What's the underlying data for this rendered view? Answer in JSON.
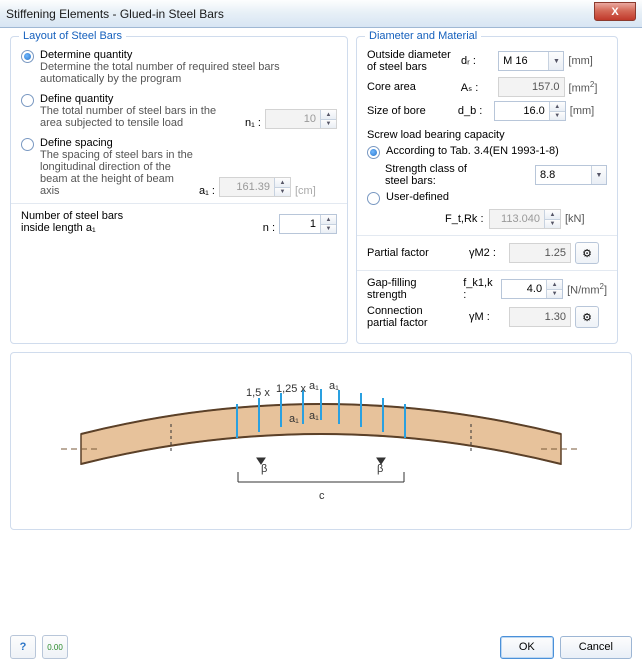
{
  "title": "Stiffening Elements - Glued-in Steel Bars",
  "close_x": "X",
  "left": {
    "legend": "Layout of Steel Bars",
    "opt1_title": "Determine quantity",
    "opt1_desc": "Determine the total number of required steel bars automatically by the program",
    "opt2_title": "Define quantity",
    "opt2_desc": "The total number of steel bars in the area subjected to tensile load",
    "opt2_sym": "n₁ :",
    "opt2_val": "10",
    "opt3_title": "Define spacing",
    "opt3_desc": "The spacing of steel bars in the longitudinal direction of the beam at the height of beam axis",
    "opt3_sym": "a₁ :",
    "opt3_val": "161.39",
    "opt3_unit": "[cm]",
    "nbars_lbl1": "Number of steel bars",
    "nbars_lbl2": "inside length a₁",
    "nbars_sym": "n :",
    "nbars_val": "1"
  },
  "right": {
    "legend": "Diameter and Material",
    "od_lbl1": "Outside diameter",
    "od_lbl2": "of steel bars",
    "od_sym": "dᵣ :",
    "od_val": "M 16",
    "od_unit": "[mm]",
    "core_lbl": "Core area",
    "core_sym": "Aₛ :",
    "core_val": "157.0",
    "core_unit_pre": "[mm",
    "core_unit_sup": "2",
    "core_unit_post": "]",
    "bore_lbl": "Size of bore",
    "bore_sym": "d_b :",
    "bore_val": "16.0",
    "bore_unit": "[mm]",
    "screw_lbl": "Screw load bearing capacity",
    "acc_lbl": "According to Tab. 3.4(EN 1993-1-8)",
    "strength_lbl1": "Strength class of",
    "strength_lbl2": "steel bars:",
    "strength_val": "8.8",
    "user_lbl": "User-defined",
    "ftrk_sym": "F_t,Rk :",
    "ftrk_val": "113.040",
    "ftrk_unit": "[kN]",
    "pf_lbl": "Partial factor",
    "pf_sym": "γM2 :",
    "pf_val": "1.25",
    "gap_lbl1": "Gap-filling",
    "gap_lbl2": "strength",
    "gap_sym": "f_k1,k :",
    "gap_val": "4.0",
    "gap_unit_pre": "[N/mm",
    "gap_unit_sup": "2",
    "gap_unit_post": "]",
    "conn_lbl1": "Connection",
    "conn_lbl2": "partial factor",
    "conn_sym": "γM :",
    "conn_val": "1.30"
  },
  "diagram": {
    "a1": "a₁",
    "m15": "1,5 x",
    "m125": "1,25 x",
    "beta": "β",
    "c": "c"
  },
  "footer": {
    "ok": "OK",
    "cancel": "Cancel"
  }
}
